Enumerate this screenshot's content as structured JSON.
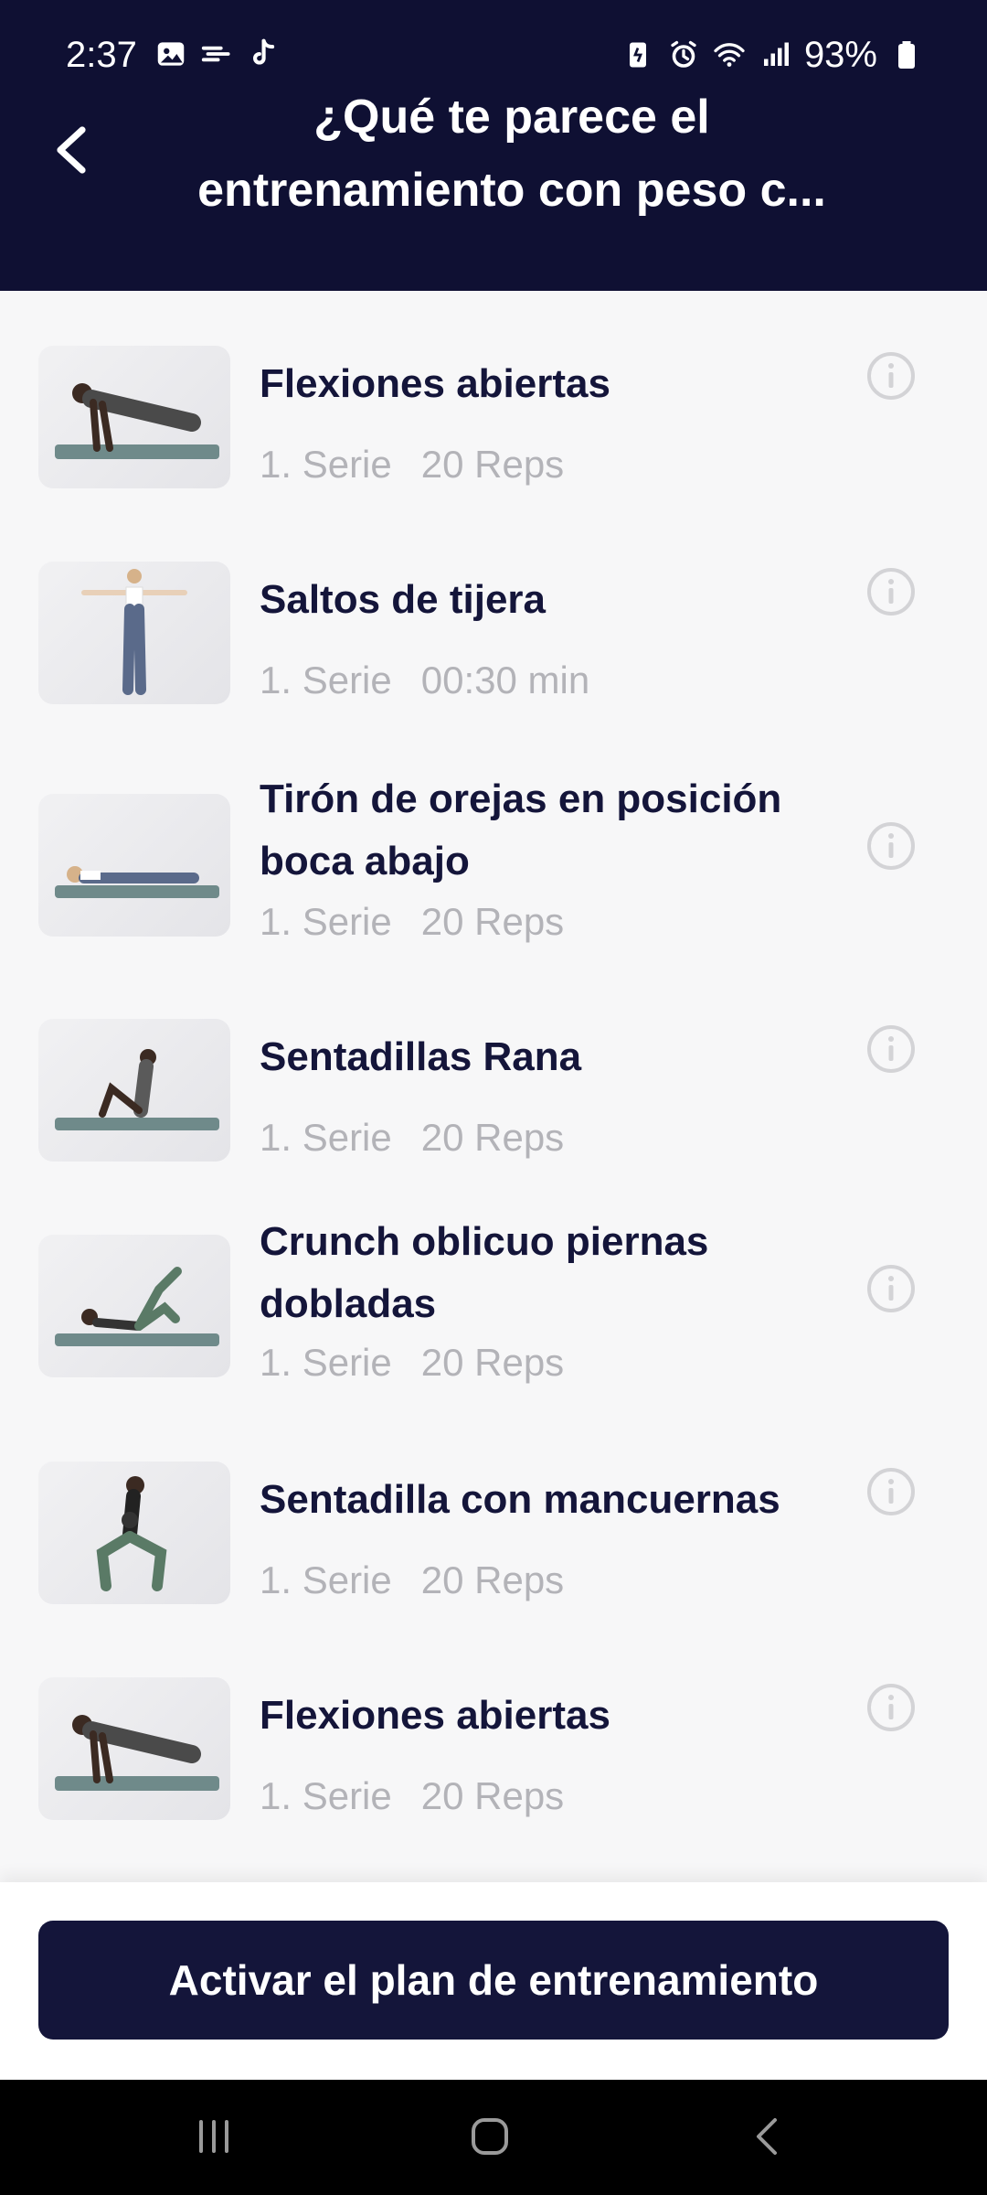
{
  "status_bar": {
    "time": "2:37",
    "battery": "93%",
    "left_icons": [
      "gallery-icon",
      "wind-icon",
      "tiktok-icon"
    ],
    "right_icons": [
      "battery-saver-icon",
      "alarm-icon",
      "wifi-icon",
      "signal-icon",
      "battery-icon"
    ]
  },
  "header": {
    "title": "¿Qué te parece el entrenamiento con peso c...",
    "back_icon": "chevron-left-icon"
  },
  "exercises": [
    {
      "name": "Flexiones abiertas",
      "series": "1. Serie",
      "amount": "20 Reps"
    },
    {
      "name": "Saltos de tijera",
      "series": "1. Serie",
      "amount": "00:30 min"
    },
    {
      "name": "Tirón de orejas en posición boca abajo",
      "series": "1. Serie",
      "amount": "20 Reps"
    },
    {
      "name": "Sentadillas Rana",
      "series": "1. Serie",
      "amount": "20 Reps"
    },
    {
      "name": "Crunch oblicuo piernas dobladas",
      "series": "1. Serie",
      "amount": "20 Reps"
    },
    {
      "name": "Sentadilla con mancuernas",
      "series": "1. Serie",
      "amount": "20 Reps"
    },
    {
      "name": "Flexiones abiertas",
      "series": "1. Serie",
      "amount": "20 Reps"
    }
  ],
  "actions": {
    "activate_label": "Activar el plan de entrenamiento"
  },
  "colors": {
    "primary": "#14153a",
    "header_bg": "#0f1033",
    "muted_text": "#b3b3b8",
    "list_bg": "#f7f7f8"
  }
}
